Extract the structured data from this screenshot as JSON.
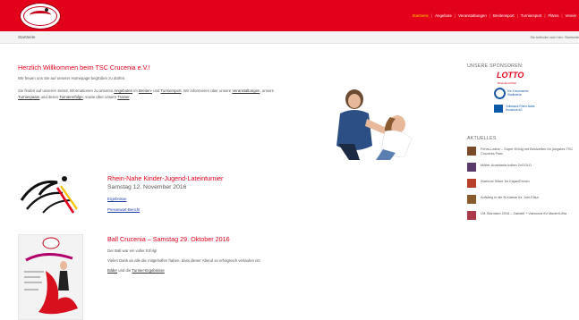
{
  "header": {
    "logo_alt": "TSC Crucenia",
    "nav": [
      "Startseite",
      "Angebote",
      "Veranstaltungen",
      "Breitensport",
      "Turniersport",
      "Fläms",
      "Verein"
    ]
  },
  "subheader": {
    "breadcrumb": "Startseite",
    "you_are_here": "Sie befinden sich hier: Startseite"
  },
  "intro": {
    "title": "Herzlich Willkommen beim TSC Crucenia e.V.!",
    "line1": "Wir freuen uns Sie auf unserer Homepage begrüßen zu dürfen.",
    "p2_a": "Sie finden auf unseren Seiten Informationen zu unseren ",
    "p2_link1": "Angeboten",
    "p2_b": " im ",
    "p2_link2": "Breiten-",
    "p2_c": " und ",
    "p2_link3": "Turniersport",
    "p2_d": ". Wir informieren über unsere ",
    "p2_link4": "Veranstaltungen",
    "p2_e": ", unsere ",
    "p2_link5": "Turnierpaare",
    "p2_f": " und deren ",
    "p2_link6": "Turniererfolge",
    "p2_g": ", sowie über unsere ",
    "p2_link7": "Trainer",
    "p2_h": "."
  },
  "sidebar": {
    "sponsors_heading": "UNSERE SPONSOREN:",
    "sponsor_lotto": "LOTTO",
    "sponsor_lotto_sub": "Rheinland-Pfalz",
    "sponsor_spk": "Die Kreuznacher Stadtwerke",
    "sponsor_vb": "Volksbank Rhein-Nahe-Hunsrück eG",
    "news_heading": "AKTUELLES",
    "news": [
      {
        "title": "Fehrs-Latine – Super Erfolg mit Bestzeiten für jüngstes TSC Crucenia Paar",
        "color": "#7a4a2a"
      },
      {
        "title": "Möller-Anastasia holten 2xGOLD",
        "color": "#5a3a6a"
      },
      {
        "title": "Zweimal Silber für Kajan/Ermen",
        "color": "#b8402a"
      },
      {
        "title": "Aufstieg in die B-Klasse für Joel-Elisa",
        "color": "#8a5a2a"
      },
      {
        "title": "LM-Standard 2016 – Zaklatil + Vakrusza für Mader/Uhia",
        "color": "#aa3a4a"
      }
    ]
  },
  "events": [
    {
      "title": "Rhein-Nahe Kinder-Jugend-Lateinturnier",
      "date": "Samstag 12. November 2016",
      "link1": "Ergebnisse",
      "link2": "Pressewart-Bericht"
    },
    {
      "title": "Ball Crucenia – Samstag 29. Oktober 2016",
      "line1": "Der Ball war ein voller Erfolg!",
      "line2": "Vielen Dank an alle die mitgeholfen haben, dass dieser Abend so erfolgreich verlaufen ist!",
      "line3_link1": "Bilder",
      "line3_mid": " und die ",
      "line3_link2": "Turnier-Ergebnisse",
      "poster_title": "Ball Crucenia"
    }
  ],
  "colors": {
    "accent": "#e2001a",
    "link": "#1e3ea8",
    "nav_active": "#ffcc00"
  }
}
